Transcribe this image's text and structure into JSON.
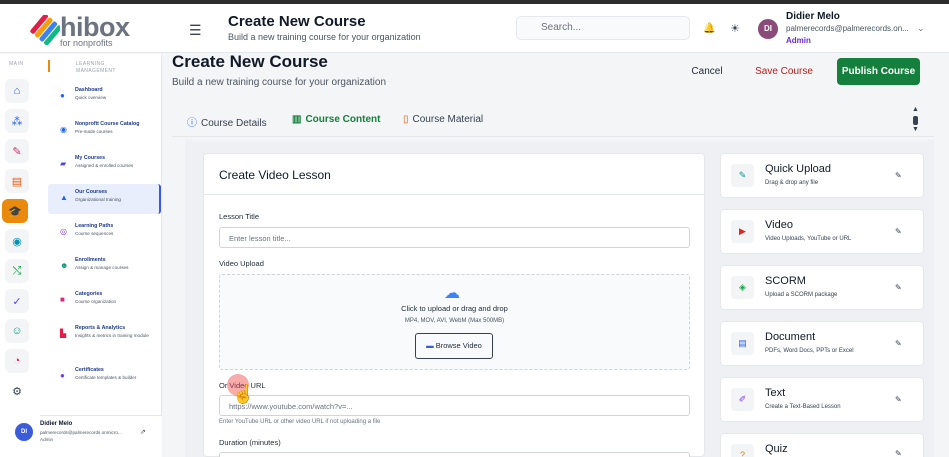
{
  "header": {
    "logo_word": "hibox",
    "logo_sub": "for nonprofits",
    "title": "Create New Course",
    "subtitle": "Build a new training course for your organization",
    "search_placeholder": "Search...",
    "user_name": "Didier Melo",
    "user_email": "palmerecords@palmerecords.on...",
    "user_role": "Admin",
    "avatar_initials": "DI"
  },
  "sidebar": {
    "rail_label": "MAIN",
    "section_label": "LEARNING MANAGEMENT",
    "items": [
      {
        "label": "Dashboard",
        "sub": "Quick overview",
        "icon": "dashboard-icon"
      },
      {
        "label": "Nonprofit Course Catalog",
        "sub": "Pre-made courses",
        "icon": "catalog-icon"
      },
      {
        "label": "My Courses",
        "sub": "Assigned & enrolled courses",
        "icon": "book-icon"
      },
      {
        "label": "Our Courses",
        "sub": "Organizational training",
        "icon": "graduation-icon"
      },
      {
        "label": "Learning Paths",
        "sub": "Course sequences",
        "icon": "path-icon"
      },
      {
        "label": "Enrollments",
        "sub": "Assign & manage courses",
        "icon": "users-icon"
      },
      {
        "label": "Categories",
        "sub": "Course organization",
        "icon": "folder-icon"
      },
      {
        "label": "Reports & Analytics",
        "sub": "Insights & metrics in training module",
        "icon": "chart-icon"
      },
      {
        "label": "Certificates",
        "sub": "Certificate templates & builder",
        "icon": "certificate-icon"
      }
    ],
    "user_name": "Didier Melo",
    "user_email": "palmerecords@palmerecords.onmicro...",
    "user_role": "Admin",
    "avatar_initials": "DI"
  },
  "main": {
    "title": "Create New Course",
    "subtitle": "Build a new training course for your organization",
    "cancel_label": "Cancel",
    "save_label": "Save Course",
    "publish_label": "Publish Course",
    "tabs": [
      {
        "label": "Course Details",
        "icon": "info-icon"
      },
      {
        "label": "Course Content",
        "icon": "book-icon"
      },
      {
        "label": "Course Material",
        "icon": "file-icon"
      }
    ],
    "active_tab": "Course Content"
  },
  "lesson_form": {
    "title": "Create Video Lesson",
    "lesson_title_label": "Lesson Title",
    "lesson_title_placeholder": "Enter lesson title...",
    "video_upload_label": "Video Upload",
    "dropzone_text": "Click to upload or drag and drop",
    "dropzone_formats": "MP4, MOV, AVI, WebM (Max 500MB)",
    "browse_label": "Browse Video",
    "video_url_label": "Or Video URL",
    "video_url_placeholder": "https://www.youtube.com/watch?v=...",
    "video_url_help": "Enter YouTube URL or other video URL if not uploading a file",
    "duration_label": "Duration (minutes)"
  },
  "lesson_types": [
    {
      "title": "Quick Upload",
      "sub": "Drag & drop any file",
      "icon": "pencil-icon",
      "color": "#0d9488"
    },
    {
      "title": "Video",
      "sub": "Video Uploads, YouTube or URL",
      "icon": "play-icon",
      "color": "#dc2626"
    },
    {
      "title": "SCORM",
      "sub": "Upload a SCORM package",
      "icon": "package-icon",
      "color": "#16a34a"
    },
    {
      "title": "Document",
      "sub": "PDFs, Word Docs, PPTs or Excel",
      "icon": "document-icon",
      "color": "#2563eb"
    },
    {
      "title": "Text",
      "sub": "Create a Text-Based Lesson",
      "icon": "edit-icon",
      "color": "#7c3aed"
    },
    {
      "title": "Quiz",
      "sub": "",
      "icon": "quiz-icon",
      "color": "#ca8a04"
    }
  ],
  "colors": {
    "accent": "#15803d",
    "active_nav": "#ea8a0c",
    "danger": "#b91c1c"
  }
}
